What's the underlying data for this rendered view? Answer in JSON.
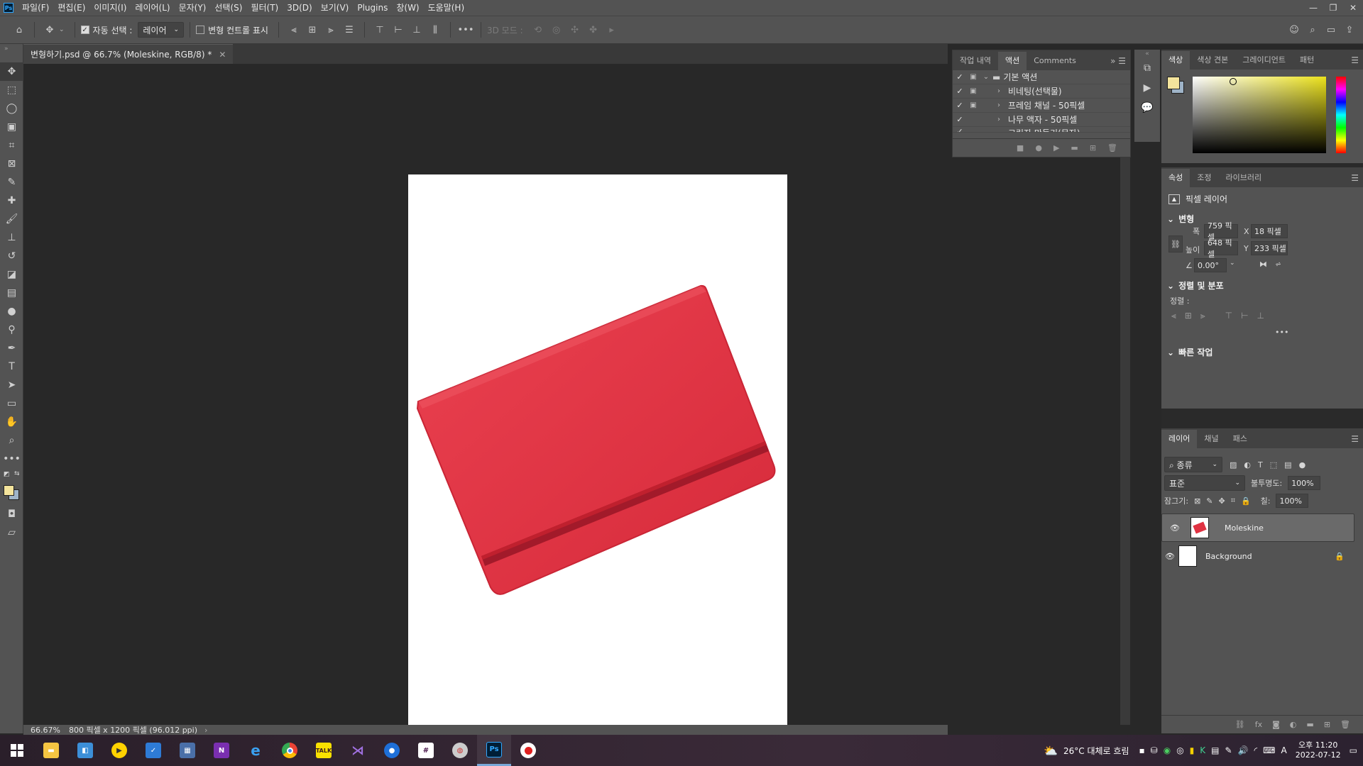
{
  "app": {
    "menu": [
      "파일(F)",
      "편집(E)",
      "이미지(I)",
      "레이어(L)",
      "문자(Y)",
      "선택(S)",
      "필터(T)",
      "3D(D)",
      "보기(V)",
      "Plugins",
      "창(W)",
      "도움말(H)"
    ]
  },
  "options": {
    "auto_select_label": "자동 선택 :",
    "auto_select_value": "레이어",
    "transform_label": "변형 컨트롤 표시",
    "mode3d_label": "3D 모드 :"
  },
  "document": {
    "tab_title": "변형하기.psd @ 66.7% (Moleskine, RGB/8) *",
    "zoom": "66.67%",
    "info": "800 픽셀 x 1200 픽셀 (96.012 ppi)",
    "notebook_color": "#e03242",
    "band_color": "#a21a2a"
  },
  "actions_panel": {
    "tabs": [
      "작업 내역",
      "액션",
      "Comments"
    ],
    "active_tab": "액션",
    "rows": [
      {
        "label": "기본 액션",
        "checked": true,
        "folder": true
      },
      {
        "label": "비네팅(선택물)",
        "checked": true
      },
      {
        "label": "프레임 채널 - 50픽셀",
        "checked": true
      },
      {
        "label": "나무 액자 - 50픽셀",
        "checked": true
      },
      {
        "label": "그림자 만들기(문자)",
        "checked": true
      }
    ]
  },
  "color_panel": {
    "tabs": [
      "색상",
      "색상 견본",
      "그레이디언트",
      "패턴"
    ],
    "foreground": "#f4e49c",
    "background": "#9fb4c8",
    "hue": "#ece21c"
  },
  "properties_panel": {
    "tabs": [
      "속성",
      "조정",
      "라이브러리"
    ],
    "layer_type": "픽셀 레이어",
    "transform_title": "변형",
    "w_label": "폭",
    "w_value": "759 픽셀",
    "h_label": "높이",
    "h_value": "648 픽셀",
    "x_label": "X",
    "x_value": "18 픽셀",
    "y_label": "Y",
    "y_value": "233 픽셀",
    "angle_value": "0.00°",
    "align_title": "정렬 및 분포",
    "align_label": "정렬 :",
    "quick_title": "빠른 작업"
  },
  "layers_panel": {
    "tabs": [
      "레이어",
      "채널",
      "패스"
    ],
    "filter_label": "종류",
    "blend_mode": "표준",
    "opacity_label": "불투명도:",
    "opacity_value": "100%",
    "lock_label": "잠그기:",
    "fill_label": "칠:",
    "fill_value": "100%",
    "layers": [
      {
        "name": "Moleskine",
        "selected": true
      },
      {
        "name": "Background",
        "locked": true
      }
    ]
  },
  "taskbar": {
    "weather": "26°C 대체로 흐림",
    "time": "오후 11:20",
    "date": "2022-07-12",
    "lang": "A"
  }
}
